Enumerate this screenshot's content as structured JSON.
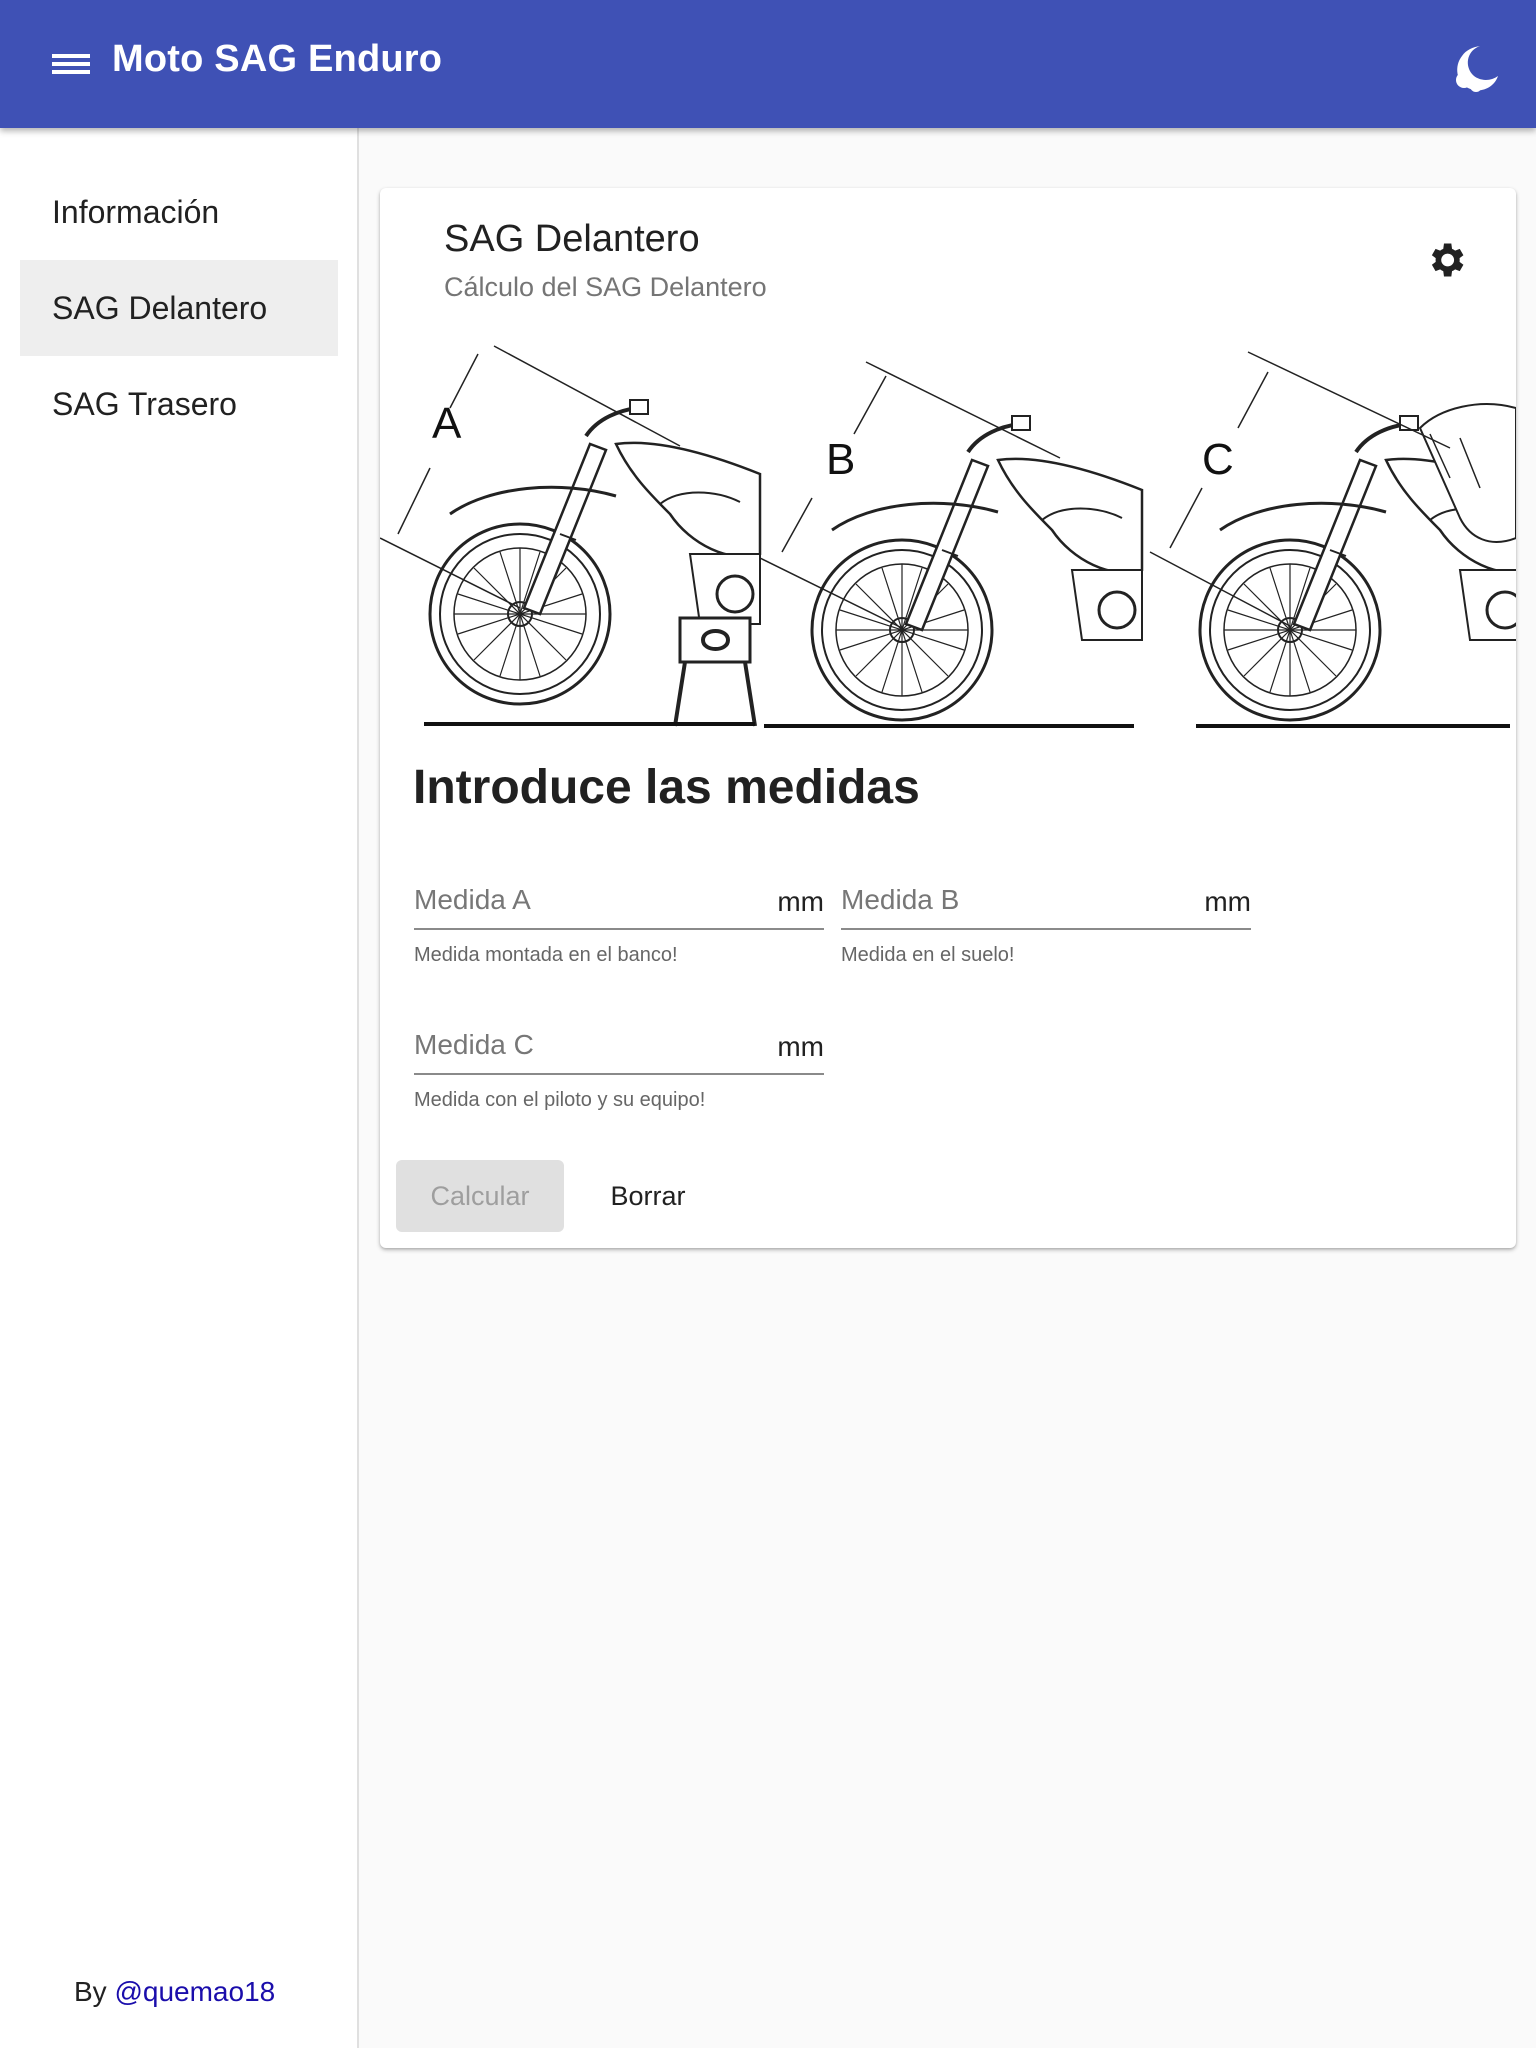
{
  "app": {
    "title": "Moto SAG Enduro",
    "accent_color": "#3f51b5"
  },
  "sidebar": {
    "items": [
      {
        "label": "Información",
        "active": false
      },
      {
        "label": "SAG Delantero",
        "active": true
      },
      {
        "label": "SAG Trasero",
        "active": false
      }
    ],
    "footer_prefix": "By",
    "footer_link": "@quemao18"
  },
  "card": {
    "title": "SAG Delantero",
    "subtitle": "Cálculo del SAG Delantero",
    "illustration_labels": [
      "A",
      "B",
      "C"
    ],
    "heading": "Introduce las medidas",
    "fields": [
      {
        "placeholder": "Medida A",
        "value": "",
        "suffix": "mm",
        "hint": "Medida montada en el banco!"
      },
      {
        "placeholder": "Medida B",
        "value": "",
        "suffix": "mm",
        "hint": "Medida en el suelo!"
      },
      {
        "placeholder": "Medida C",
        "value": "",
        "suffix": "mm",
        "hint": "Medida con el piloto y su equipo!"
      }
    ],
    "calculate_label": "Calcular",
    "clear_label": "Borrar"
  },
  "icons": {
    "menu": "menu-icon",
    "theme": "theme-toggle-icon",
    "settings": "gear-icon"
  }
}
